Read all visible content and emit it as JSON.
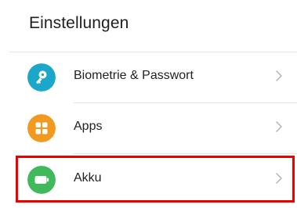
{
  "header": {
    "title": "Einstellungen"
  },
  "items": [
    {
      "label": "Biometrie & Passwort",
      "icon": "key-icon",
      "icon_color": "#1aa7c9"
    },
    {
      "label": "Apps",
      "icon": "apps-grid-icon",
      "icon_color": "#f2991f"
    },
    {
      "label": "Akku",
      "icon": "battery-icon",
      "icon_color": "#3fb95a",
      "highlighted": true
    }
  ],
  "colors": {
    "highlight_border": "#ee0000",
    "chevron": "#b4b4b4",
    "divider": "#e6e6e6"
  }
}
